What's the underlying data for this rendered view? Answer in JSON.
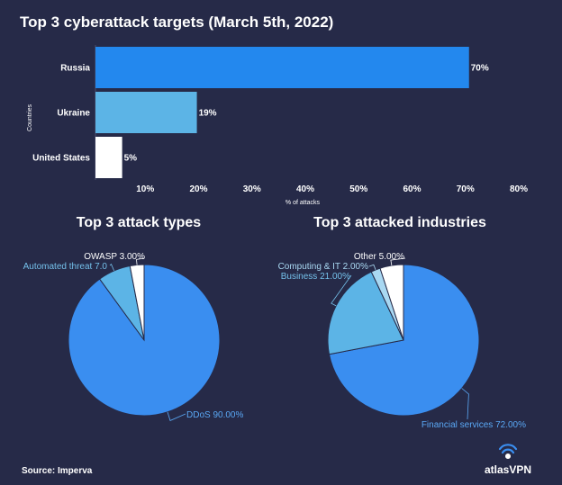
{
  "chart_data": [
    {
      "type": "bar",
      "orientation": "horizontal",
      "title": "Top 3 cyberattack targets (March 5th, 2022)",
      "categories": [
        "Russia",
        "Ukraine",
        "United States"
      ],
      "values": [
        70,
        19,
        5
      ],
      "value_labels": [
        "70%",
        "19%",
        "5%"
      ],
      "colors": [
        "#2388ee",
        "#5cb4e6",
        "#ffffff"
      ],
      "xlabel": "% of attacks",
      "ylabel": "Countries",
      "xlim": [
        0,
        80
      ],
      "xticks": [
        10,
        20,
        30,
        40,
        50,
        60,
        70,
        80
      ],
      "xtick_labels": [
        "10%",
        "20%",
        "30%",
        "40%",
        "50%",
        "60%",
        "70%",
        "80%"
      ],
      "grid": false
    },
    {
      "type": "pie",
      "title": "Top 3 attack types",
      "slices": [
        {
          "label": "DDoS 90.00%",
          "value": 90,
          "color": "#3a8ef0",
          "label_color": "#5aa8f5"
        },
        {
          "label": "Automated threat 7.0",
          "value": 7,
          "color": "#5cb4e6",
          "label_color": "#74c0ea"
        },
        {
          "label": "OWASP 3.00%",
          "value": 3,
          "color": "#ffffff",
          "label_color": "#ffffff"
        }
      ]
    },
    {
      "type": "pie",
      "title": "Top 3 attacked industries",
      "slices": [
        {
          "label": "Financial services 72.00%",
          "value": 72,
          "color": "#3a8ef0",
          "label_color": "#5aa8f5"
        },
        {
          "label": "Business 21.00%",
          "value": 21,
          "color": "#5cb4e6",
          "label_color": "#74c0ea"
        },
        {
          "label": "Computing & IT 2.00%",
          "value": 2,
          "color": "#a9d8f2",
          "label_color": "#a9d8f2"
        },
        {
          "label": "Other 5.00%",
          "value": 5,
          "color": "#ffffff",
          "label_color": "#ffffff"
        }
      ]
    }
  ],
  "footer": {
    "source": "Source: Imperva",
    "brand": "atlasVPN"
  },
  "colors": {
    "background": "#262a48",
    "text": "#ffffff"
  }
}
